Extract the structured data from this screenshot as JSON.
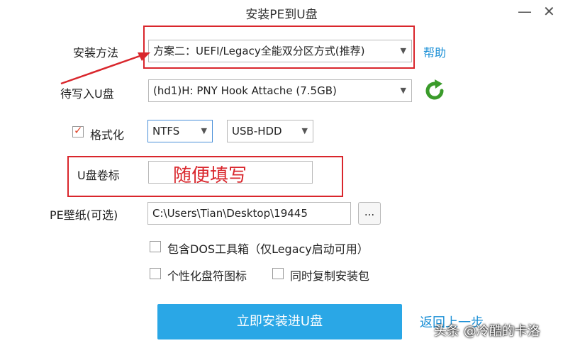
{
  "window": {
    "title": "安装PE到U盘",
    "minimize": "—",
    "close": "✕"
  },
  "install_method": {
    "label": "安装方法",
    "value": "方案二：UEFI/Legacy全能双分区方式(推荐)",
    "help": "帮助"
  },
  "target_disk": {
    "label": "待写入U盘",
    "value": "(hd1)H: PNY Hook Attache (7.5GB)"
  },
  "format": {
    "label": "格式化",
    "checked": true,
    "fs_value": "NTFS",
    "mode_value": "USB-HDD"
  },
  "volume_label": {
    "label": "U盘卷标",
    "value": "",
    "annotation": "随便填写"
  },
  "wallpaper": {
    "label": "PE壁纸(可选)",
    "value": "C:\\Users\\Tian\\Desktop\\19445",
    "browse": "..."
  },
  "options": {
    "dos_tools": "包含DOS工具箱（仅Legacy启动可用）",
    "custom_icon": "个性化盘符图标",
    "copy_package": "同时复制安装包"
  },
  "actions": {
    "install": "立即安装进U盘",
    "back": "返回上一步"
  },
  "watermark": "头条 @冷酷的卡洛",
  "colors": {
    "accent": "#2aa7e6",
    "link": "#1a8fd6",
    "annotation_red": "#d9262c"
  }
}
